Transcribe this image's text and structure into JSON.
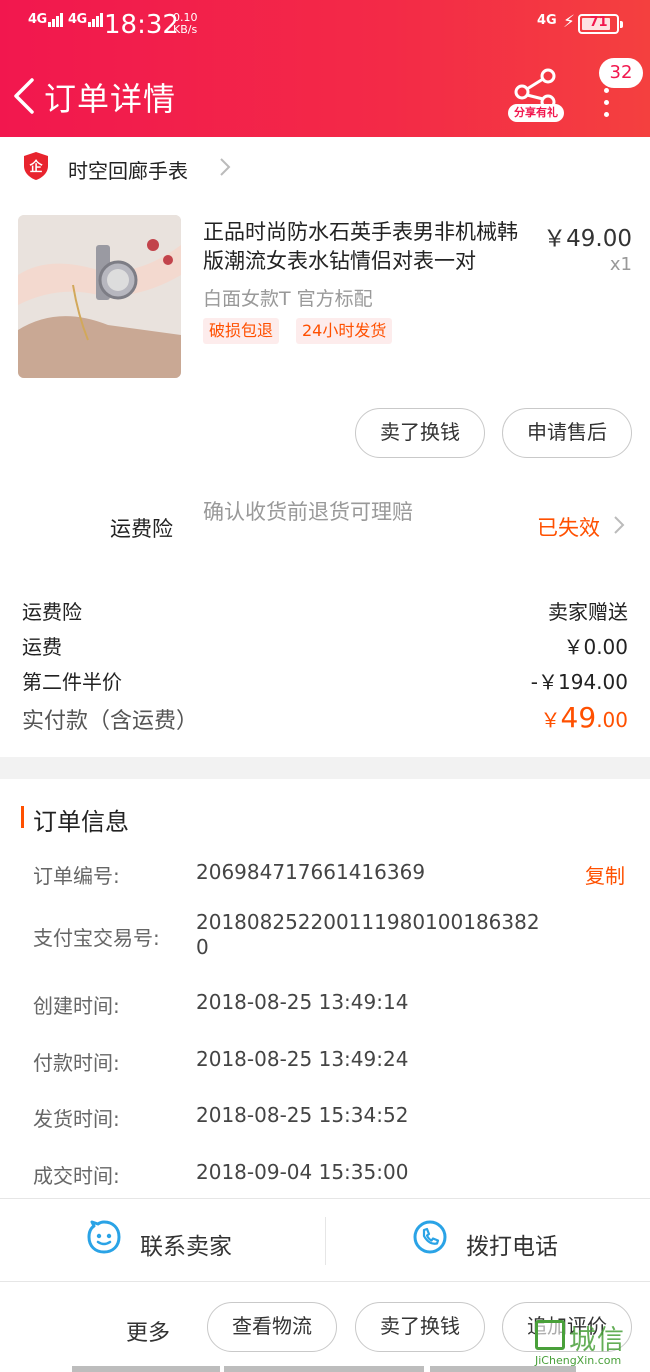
{
  "status_bar": {
    "signal1": "4G",
    "signal2": "4G",
    "time": "18:32",
    "speed_value": "0.10",
    "speed_unit": "KB/s",
    "signal_right": "4G",
    "battery": "71"
  },
  "header": {
    "title": "订单详情",
    "share_label": "分享有礼",
    "badge_count": "32"
  },
  "store": {
    "name": "时空回廊手表"
  },
  "product": {
    "title": "正品时尚防水石英手表男非机械韩版潮流女表水钻情侣对表一对",
    "price": "￥49.00",
    "quantity": "x1",
    "sku": "白面女款T 官方标配",
    "tags": [
      "破损包退",
      "24小时发货"
    ]
  },
  "item_actions": {
    "sell_label": "卖了换钱",
    "aftersale_label": "申请售后"
  },
  "insurance": {
    "label": "运费险",
    "description": "确认收货前退货可理赔",
    "status": "已失效"
  },
  "fees": [
    {
      "label": "运费险",
      "value": "卖家赠送"
    },
    {
      "label": "运费",
      "value": "￥0.00"
    },
    {
      "label": "第二件半价",
      "value": "-￥194.00"
    }
  ],
  "total": {
    "label": "实付款（含运费）",
    "currency": "￥",
    "integer": "49",
    "decimal": ".00"
  },
  "order_info": {
    "title": "订单信息",
    "copy_label": "复制",
    "rows": [
      {
        "label": "订单编号:",
        "value": "206984717661416369"
      },
      {
        "label": "支付宝交易号:",
        "value": "2018082522001119801001863820"
      },
      {
        "label": "创建时间:",
        "value": "2018-08-25 13:49:14"
      },
      {
        "label": "付款时间:",
        "value": "2018-08-25 13:49:24"
      },
      {
        "label": "发货时间:",
        "value": "2018-08-25 15:34:52"
      },
      {
        "label": "成交时间:",
        "value": "2018-09-04 15:35:00"
      }
    ]
  },
  "contact": {
    "seller_label": "联系卖家",
    "call_label": "拨打电话"
  },
  "bottom_bar": {
    "more_label": "更多",
    "logistics_label": "查看物流",
    "sell_label": "卖了换钱",
    "review_label": "追加评价"
  },
  "watermark": {
    "text": "城信",
    "url": "JiChengXin.com"
  },
  "colors": {
    "brand_red": "#f2174e",
    "accent_orange": "#ff5000",
    "service_blue": "#2aa3e6",
    "watermark_green": "#49a03a"
  }
}
